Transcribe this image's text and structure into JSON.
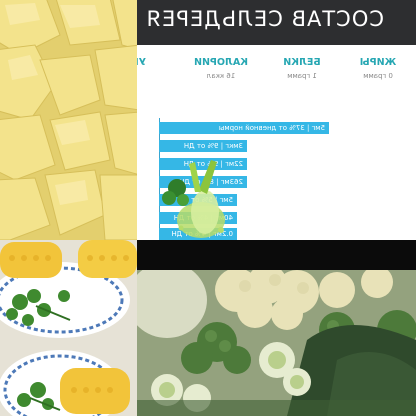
{
  "infographic": {
    "title": "СОСТАВ СЕЛЬДЕРЕЯ",
    "nutrients": [
      {
        "label": "ЖИРЫ",
        "value": "0 грамм"
      },
      {
        "label": "БЕЛКИ",
        "value": "1 грамм"
      },
      {
        "label": "КАЛОРИИ",
        "value": "16 ккал"
      },
      {
        "label": "УГ",
        "value": ""
      }
    ],
    "side_note": "...",
    "bars": [
      "5мг | 37% от дневной нормы",
      "3мкг | 9% от ДН",
      "22мг | 9% от ДН",
      "263мг | 8% от ДН",
      "5мг | 5% от ДН",
      "40мг | 4% от ДН",
      "0.2мг | 4% от ДН"
    ]
  },
  "colors": {
    "header_bg": "#2d2e30",
    "accent_teal": "#27a7b3",
    "bar_blue": "#35b7e6",
    "potato": "#e9d77a",
    "corn": "#f2c43a",
    "broccoli": "#4d7a3a"
  }
}
